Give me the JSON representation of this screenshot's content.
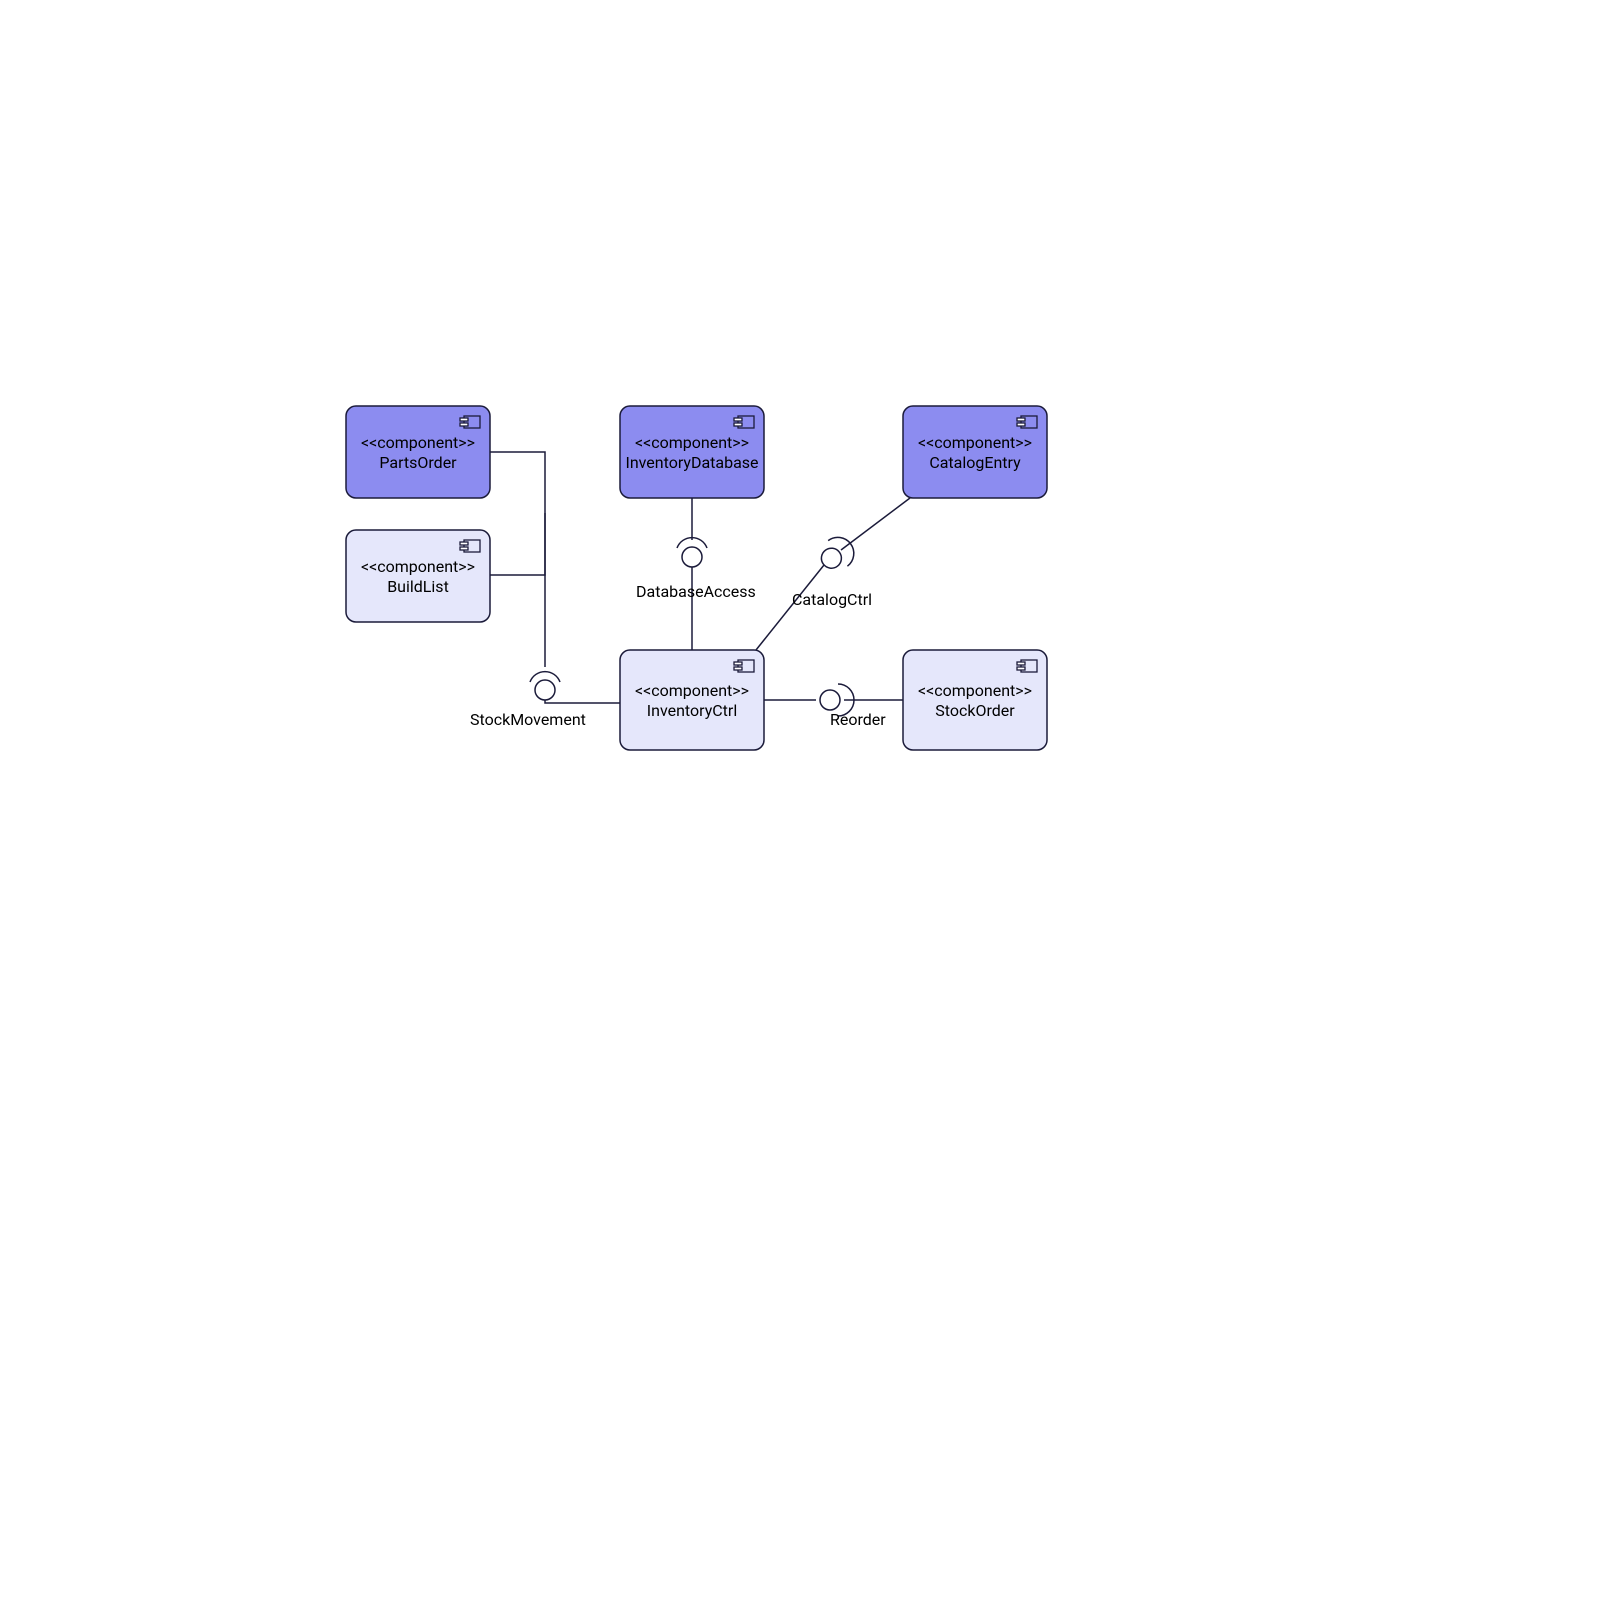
{
  "stereotype": "<<component>>",
  "components": {
    "partsOrder": {
      "name": "PartsOrder"
    },
    "buildList": {
      "name": "BuildList"
    },
    "inventoryDatabase": {
      "name": "InventoryDatabase"
    },
    "catalogEntry": {
      "name": "CatalogEntry"
    },
    "inventoryCtrl": {
      "name": "InventoryCtrl"
    },
    "stockOrder": {
      "name": "StockOrder"
    }
  },
  "interfaces": {
    "stockMovement": {
      "label": "StockMovement"
    },
    "databaseAccess": {
      "label": "DatabaseAccess"
    },
    "catalogCtrl": {
      "label": "CatalogCtrl"
    },
    "reorder": {
      "label": "Reorder"
    }
  }
}
